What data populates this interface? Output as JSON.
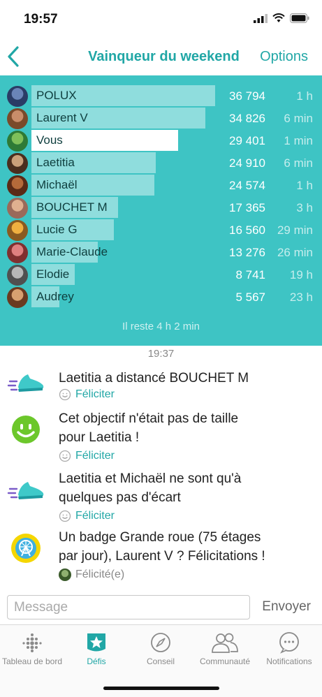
{
  "status": {
    "time": "19:57"
  },
  "nav": {
    "title": "Vainqueur du weekend",
    "options_label": "Options"
  },
  "board": {
    "rows": [
      {
        "name": "POLUX",
        "steps": "36 794",
        "ago": "1 h",
        "value": 36794,
        "is_me": false
      },
      {
        "name": "Laurent V",
        "steps": "34 826",
        "ago": "6 min",
        "value": 34826,
        "is_me": false
      },
      {
        "name": "Vous",
        "steps": "29 401",
        "ago": "1 min",
        "value": 29401,
        "is_me": true
      },
      {
        "name": "Laetitia",
        "steps": "24 910",
        "ago": "6 min",
        "value": 24910,
        "is_me": false
      },
      {
        "name": "Michaël",
        "steps": "24 574",
        "ago": "1 h",
        "value": 24574,
        "is_me": false
      },
      {
        "name": "BOUCHET M",
        "steps": "17 365",
        "ago": "3 h",
        "value": 17365,
        "is_me": false
      },
      {
        "name": "Lucie G",
        "steps": "16 560",
        "ago": "29 min",
        "value": 16560,
        "is_me": false
      },
      {
        "name": "Marie-Claude",
        "steps": "13 276",
        "ago": "26 min",
        "value": 13276,
        "is_me": false
      },
      {
        "name": "Elodie",
        "steps": "8 741",
        "ago": "19 h",
        "value": 8741,
        "is_me": false
      },
      {
        "name": "Audrey",
        "steps": "5 567",
        "ago": "23 h",
        "value": 5567,
        "is_me": false
      }
    ],
    "remaining": "Il reste 4 h 2 min"
  },
  "feed": {
    "time": "19:37",
    "items": [
      {
        "icon": "shoe-icon",
        "line1": "Laetitia a distancé BOUCHET M",
        "line2": "",
        "action": "Féliciter",
        "done": false
      },
      {
        "icon": "smiley-icon",
        "line1": "Cet objectif n'était pas de taille",
        "line2": "pour Laetitia !",
        "action": "Féliciter",
        "done": false
      },
      {
        "icon": "shoe-icon",
        "line1": "Laetitia et Michaël ne sont qu'à",
        "line2": "quelques pas d'écart",
        "action": "Féliciter",
        "done": false
      },
      {
        "icon": "ferris-wheel-badge-icon",
        "line1": "Un badge Grande roue (75 étages",
        "line2": "par jour), Laurent V ? Félicitations !",
        "action": "Félicité(e)",
        "done": true
      }
    ]
  },
  "composer": {
    "placeholder": "Message",
    "send_label": "Envoyer"
  },
  "tabs": [
    {
      "label": "Tableau de bord",
      "icon": "dots-grid-icon",
      "active": false
    },
    {
      "label": "Défis",
      "icon": "star-badge-icon",
      "active": true
    },
    {
      "label": "Conseil",
      "icon": "compass-icon",
      "active": false
    },
    {
      "label": "Communauté",
      "icon": "people-icon",
      "active": false
    },
    {
      "label": "Notifications",
      "icon": "chat-bubble-icon",
      "active": false
    }
  ],
  "colors": {
    "accent": "#21a7a6",
    "board_bg": "#3ec4c4",
    "smiley": "#6cc72b",
    "badge": "#f5d600"
  }
}
